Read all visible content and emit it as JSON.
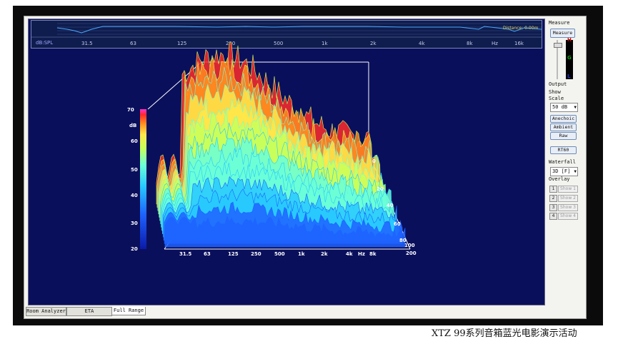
{
  "overview": {
    "db_label": "dB:SPL",
    "distance_label": "Distance: 0.00m",
    "freq_ticks": [
      "31.5",
      "63",
      "125",
      "250",
      "500",
      "1k",
      "2k",
      "4k",
      "8k",
      "Hz",
      "16k"
    ]
  },
  "waterfall_axes": {
    "db_label": "dB",
    "db_ticks": [
      "70",
      "60",
      "50",
      "40",
      "30",
      "20"
    ],
    "freq_ticks": [
      "31.5",
      "63",
      "125",
      "250",
      "500",
      "1k",
      "2k",
      "4k",
      "Hz",
      "8k"
    ],
    "time_ticks": [
      "0",
      "20",
      "40",
      "60",
      "80",
      "100",
      "200"
    ]
  },
  "right_panel": {
    "measure_label": "Measure",
    "measure_button": "Measure",
    "meter_indicator_labels": [
      "H",
      "G",
      "L"
    ],
    "output_label": "Output",
    "show_label": "Show",
    "scale_label": "Scale",
    "scale_value": "50 dB",
    "buttons": [
      "Anechoic",
      "Ambient",
      "Raw"
    ],
    "rt60_button": "RT60",
    "waterfall_label": "Waterfall",
    "waterfall_value": "3D [F]",
    "overlay_label": "Overlay",
    "overlays": [
      {
        "num": "1",
        "label": "Show 1"
      },
      {
        "num": "2",
        "label": "Show 2"
      },
      {
        "num": "3",
        "label": "Show 3"
      },
      {
        "num": "4",
        "label": "Show 4"
      }
    ]
  },
  "tabs": [
    "Room Analyzer",
    "ETA",
    "Full Range"
  ],
  "caption": "XTZ  99系列音箱蓝光电影演示活动",
  "colors": {
    "panel_bg": "#0a0f5c",
    "curve": "#4aa8ff",
    "colormap": [
      "#0b1aa8",
      "#1e63ff",
      "#27c9ff",
      "#6affd8",
      "#c8ff5a",
      "#ffe84a",
      "#ff8a20",
      "#ff2a2a",
      "#ff33cc"
    ]
  }
}
